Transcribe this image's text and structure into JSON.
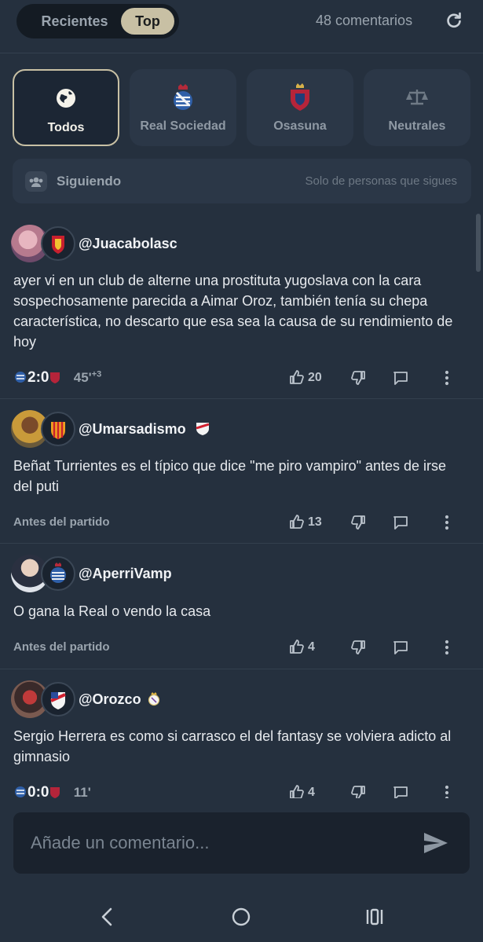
{
  "header": {
    "tabs": [
      {
        "label": "Recientes",
        "active": false
      },
      {
        "label": "Top",
        "active": true
      }
    ],
    "comment_count": "48 comentarios",
    "refresh_icon": "refresh-icon"
  },
  "filters": [
    {
      "label": "Todos",
      "icon": "globe-icon",
      "active": true
    },
    {
      "label": "Real Sociedad",
      "icon": "real-sociedad-crest-icon",
      "active": false
    },
    {
      "label": "Osasuna",
      "icon": "osasuna-crest-icon",
      "active": false
    },
    {
      "label": "Neutrales",
      "icon": "scale-icon",
      "active": false
    }
  ],
  "following": {
    "label": "Siguiendo",
    "hint": "Solo de personas que sigues",
    "icon": "people-icon"
  },
  "comments": [
    {
      "username": "@Juacabolasc",
      "badge": "mallorca-crest-icon",
      "text": "ayer vi en un club de alterne una prostituta yugoslava con la cara sospechosamente parecida a Aimar Oroz, también tenía su chepa característica, no descarto que esa sea la causa de su rendimiento de hoy",
      "score": "2:0",
      "minute": "45'",
      "added": "+3",
      "likes": "20"
    },
    {
      "username": "@Umarsadismo",
      "badge": "valencia-crest-icon",
      "text": "Beñat Turrientes es el típico que dice \"me piro vampiro\" antes de irse del puti",
      "meta": "Antes del partido",
      "likes": "13"
    },
    {
      "username": "@AperriVamp",
      "badge": "real-sociedad-crest-icon",
      "text": "O gana la Real o vendo la casa",
      "meta": "Antes del partido",
      "likes": "4"
    },
    {
      "username": "@Orozco",
      "badge": "rayo-vallecano-crest-icon",
      "text": "Sergio Herrera es como si carrasco el del fantasy se volviera adicto al gimnasio",
      "score": "0:0",
      "minute": "11'",
      "likes": "4"
    }
  ],
  "composer": {
    "placeholder": "Añade un comentario..."
  },
  "colors": {
    "background": "#25303e",
    "accent": "#c8c0a4",
    "card": "#2b3747"
  }
}
